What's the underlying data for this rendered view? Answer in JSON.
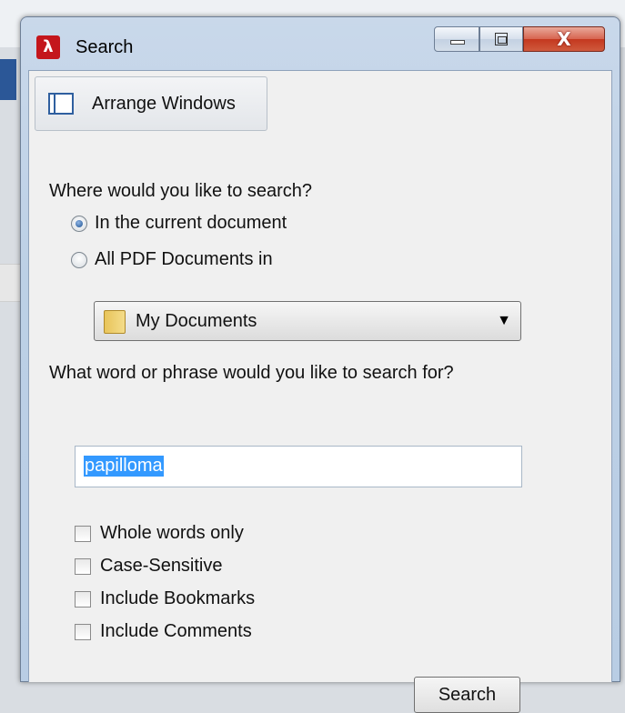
{
  "window": {
    "title": "Search",
    "app_icon": "adobe-reader-icon",
    "controls": {
      "minimize": "minimize-icon",
      "maximize": "maximize-icon",
      "close": "close-icon",
      "close_glyph": "X"
    }
  },
  "toolbar": {
    "arrange_label": "Arrange Windows",
    "arrange_icon": "arrange-windows-icon"
  },
  "location": {
    "question": "Where would you like to search?",
    "options": [
      {
        "label": "In the current document",
        "checked": true
      },
      {
        "label": "All PDF Documents in",
        "checked": false
      }
    ],
    "folder": {
      "value": "My Documents",
      "icon": "folder-icon"
    }
  },
  "query": {
    "question": "What word or phrase would you like to search for?",
    "value": "papilloma"
  },
  "options": [
    {
      "label": "Whole words only",
      "checked": false
    },
    {
      "label": "Case-Sensitive",
      "checked": false
    },
    {
      "label": "Include Bookmarks",
      "checked": false
    },
    {
      "label": "Include Comments",
      "checked": false
    }
  ],
  "actions": {
    "search_label": "Search"
  },
  "colors": {
    "selection": "#3399ff",
    "close_button": "#c4381f",
    "app_icon": "#c4161c"
  }
}
